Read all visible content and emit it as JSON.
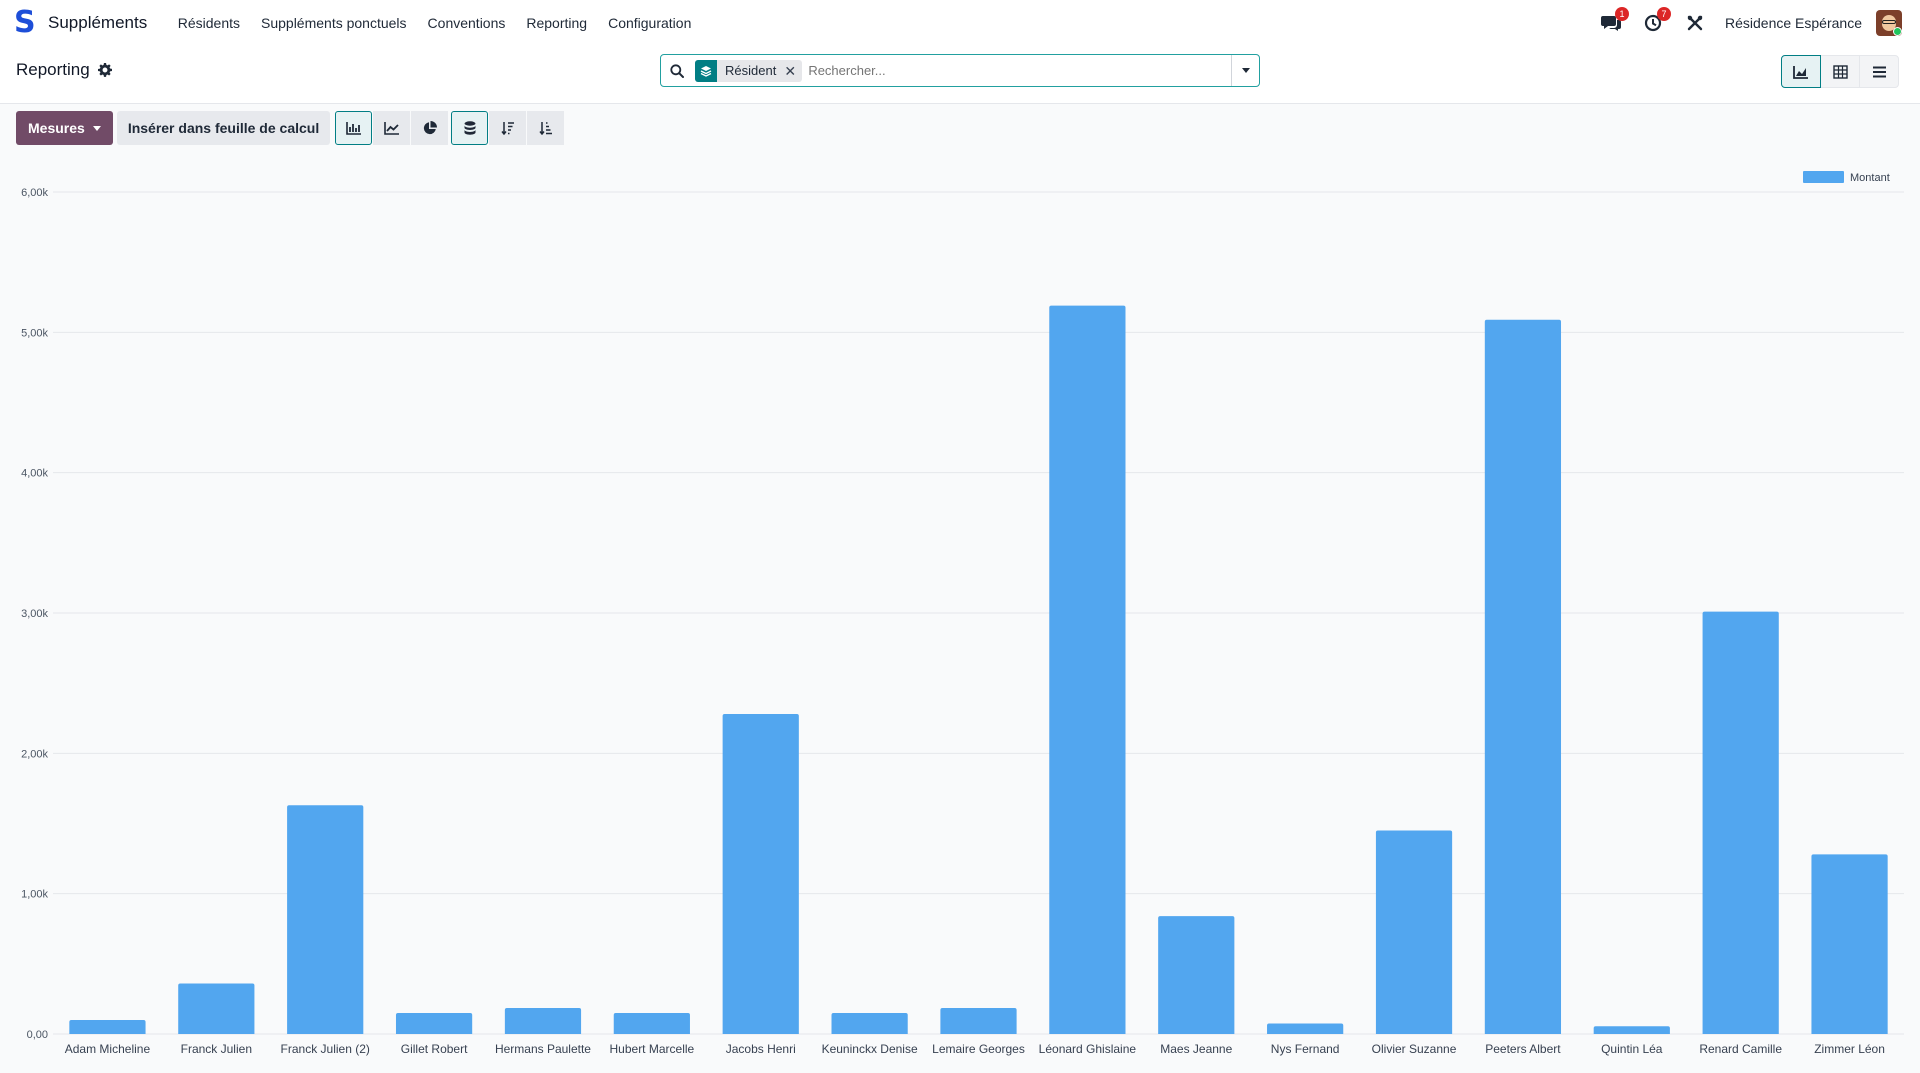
{
  "app": {
    "name": "Suppléments",
    "logo_letter": "S"
  },
  "menu": [
    "Résidents",
    "Suppléments ponctuels",
    "Conventions",
    "Reporting",
    "Configuration"
  ],
  "systray": {
    "messages_count": "1",
    "activities_count": "7",
    "company": "Résidence Espérance"
  },
  "breadcrumb": {
    "title": "Reporting"
  },
  "search": {
    "facet_label": "Résident",
    "placeholder": "Rechercher..."
  },
  "toolbar": {
    "measures_label": "Mesures",
    "insert_label": "Insérer dans feuille de calcul"
  },
  "colors": {
    "bar": "#52a6ef",
    "accent": "#714b67",
    "teal": "#017e84"
  },
  "chart_data": {
    "type": "bar",
    "categories": [
      "Adam Micheline",
      "Franck Julien",
      "Franck Julien (2)",
      "Gillet Robert",
      "Hermans Paulette",
      "Hubert Marcelle",
      "Jacobs Henri",
      "Keuninckx Denise",
      "Lemaire Georges",
      "Léonard Ghislaine",
      "Maes Jeanne",
      "Nys Fernand",
      "Olivier Suzanne",
      "Peeters Albert",
      "Quintin Léa",
      "Renard Camille",
      "Zimmer Léon"
    ],
    "series": [
      {
        "name": "Montant",
        "values": [
          100,
          360,
          1630,
          150,
          185,
          150,
          2280,
          150,
          185,
          5190,
          840,
          75,
          1450,
          5090,
          55,
          3010,
          1280
        ]
      }
    ],
    "yticks": [
      "0,00",
      "1,00k",
      "2,00k",
      "3,00k",
      "4,00k",
      "5,00k",
      "6,00k"
    ],
    "ylim": [
      0,
      6000
    ],
    "grid": true,
    "legend_position": "top-right"
  }
}
